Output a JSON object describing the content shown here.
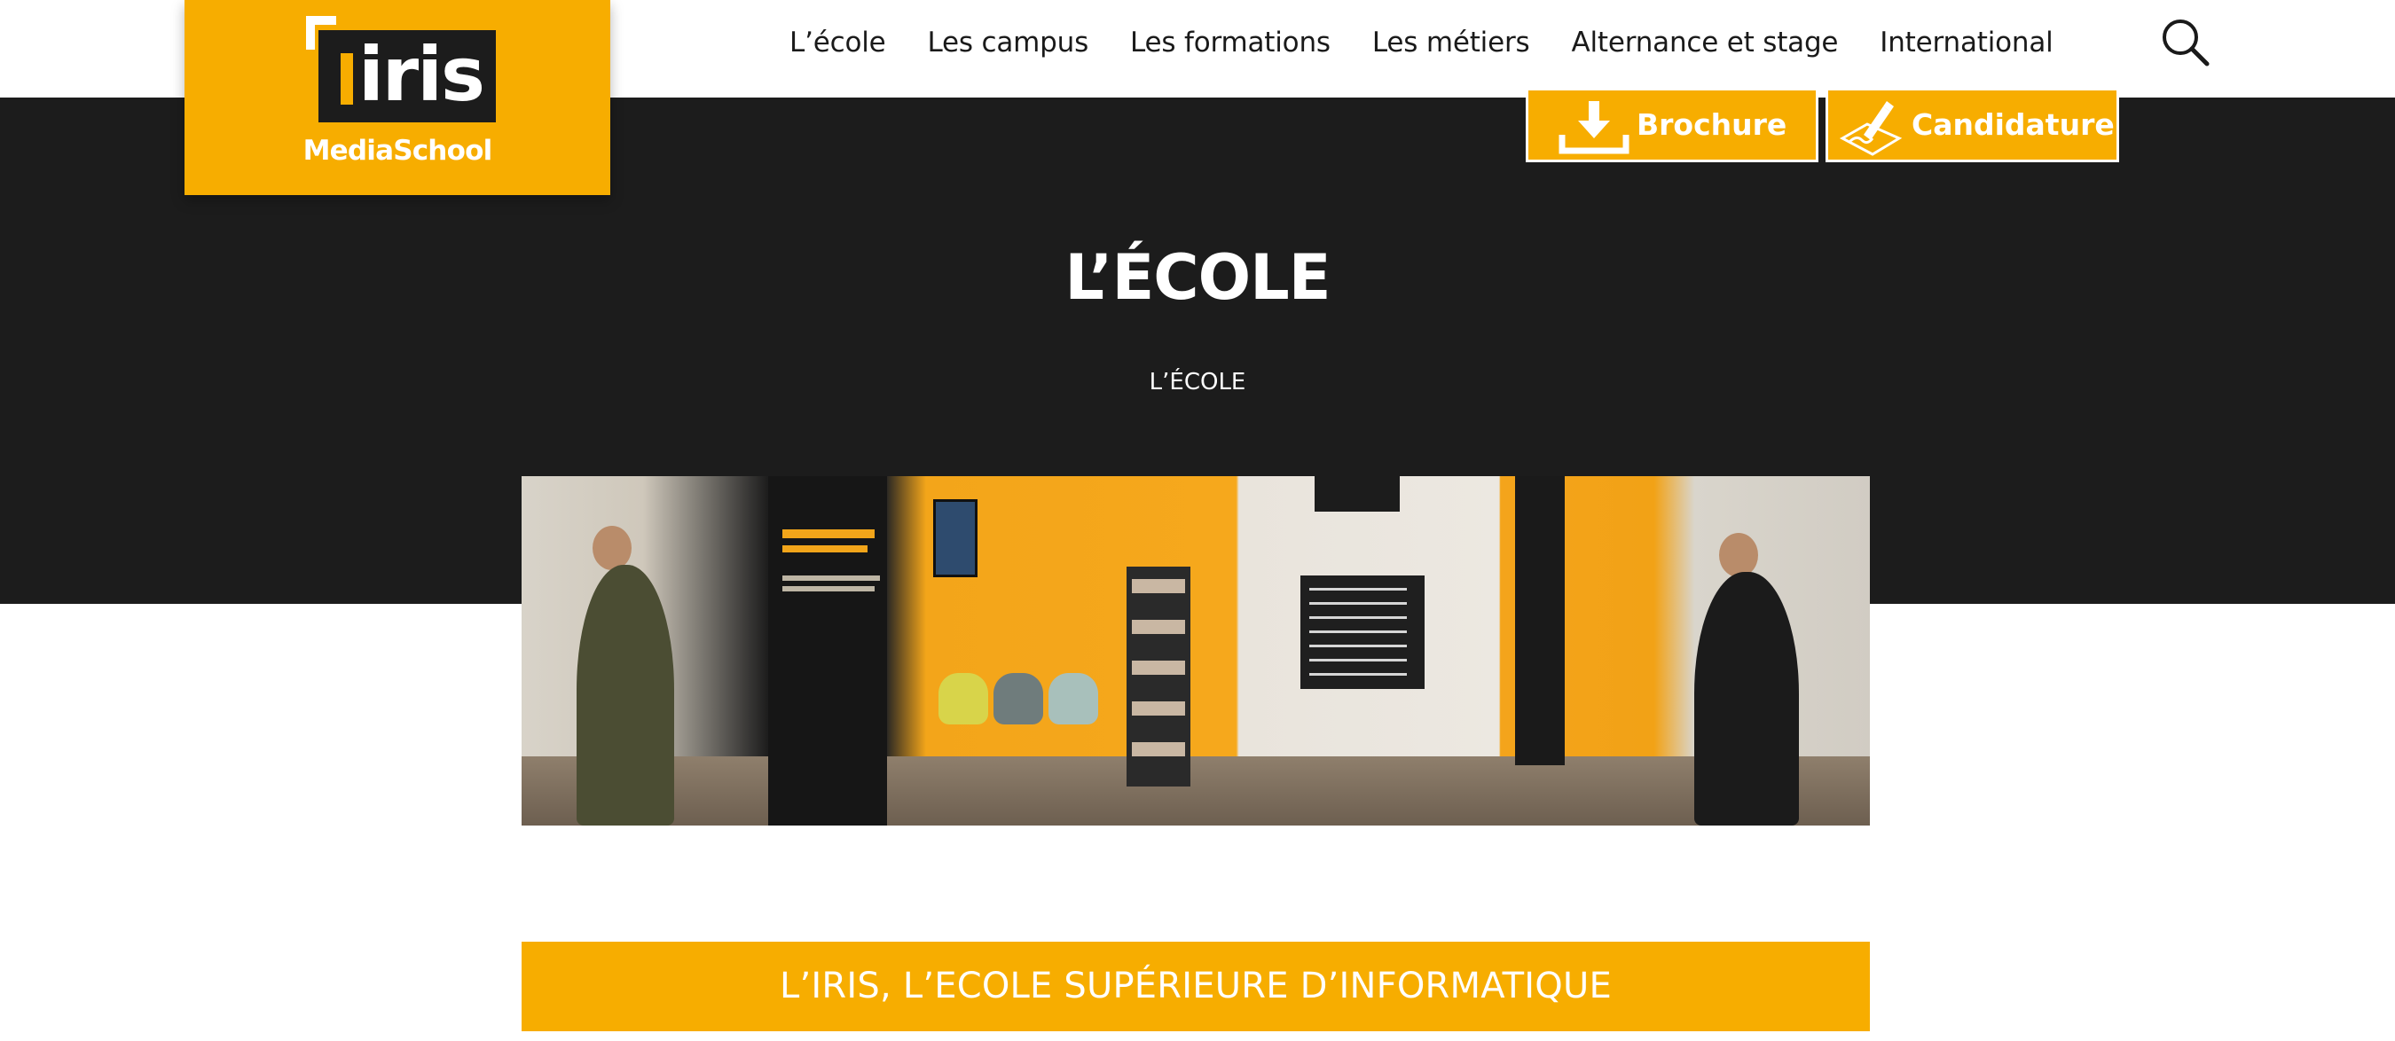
{
  "nav": {
    "items": [
      "L’école",
      "Les campus",
      "Les formations",
      "Les métiers",
      "Alternance et stage",
      "International"
    ],
    "search_icon": "search-icon"
  },
  "logo": {
    "word": "IRIS",
    "sub": "MediaSchool"
  },
  "cta": {
    "brochure_label": "Brochure",
    "brochure_icon": "download-icon",
    "candidature_label": "Candidature",
    "candidature_icon": "pen-sign-icon"
  },
  "hero": {
    "title": "L’ÉCOLE",
    "breadcrumb": "L’ÉCOLE"
  },
  "section": {
    "title": "L’IRIS, L’ECOLE SUPÉRIEURE D’INFORMATIQUE"
  },
  "colors": {
    "accent": "#f7ad00",
    "dark": "#1c1c1c",
    "text": "#1a1a1a"
  }
}
